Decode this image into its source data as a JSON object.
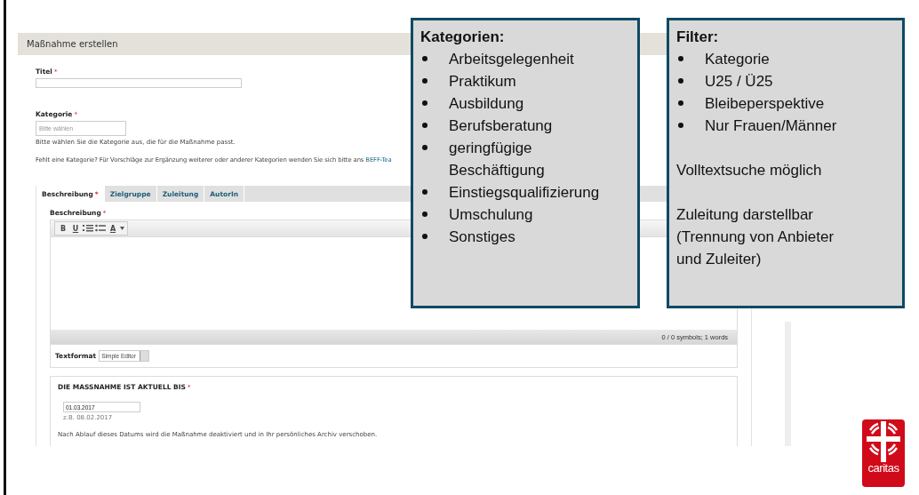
{
  "form_title": "Maßnahme erstellen",
  "title_field": {
    "label": "Titel",
    "marker": "*"
  },
  "category_field": {
    "label": "Kategorie",
    "marker": "*",
    "placeholder": "Bitte wählen",
    "help": "Bitte wählen Sie die Kategorie aus, die für die Maßnahme passt."
  },
  "missing_note": {
    "text": "Fehlt eine Kategorie? Für Vorschläge zur Ergänzung weiterer oder anderer Kategorien wenden Sie sich bitte ans",
    "link": "BEFF-Tea"
  },
  "tabs": [
    {
      "label": "Beschreibung",
      "marker": "*",
      "selected": true
    },
    {
      "label": "Zielgruppe",
      "selected": false
    },
    {
      "label": "Zuleitung",
      "selected": false
    },
    {
      "label": "AutorIn",
      "selected": false
    }
  ],
  "editor": {
    "label": "Beschreibung",
    "marker": "*",
    "toolbar": [
      {
        "kind": "bold",
        "label": "B"
      },
      {
        "kind": "underline",
        "label": "U"
      },
      {
        "kind": "ordered-list"
      },
      {
        "kind": "bullet-list"
      },
      {
        "kind": "font-color",
        "label": "A"
      }
    ],
    "status": "0 / 0 symbols; 1 words",
    "format_label": "Textformat",
    "format_value": "Simple Editor"
  },
  "valid_until": {
    "heading": "DIE MASSNAHME IST AKTUELL BIS",
    "marker": "*",
    "value": "01.03.2017",
    "example": "z.B. 08.02.2017",
    "note": "Nach Ablauf dieses Datums wird die Maßnahme deaktiviert und in Ihr persönliches Archiv verschoben."
  },
  "callouts": [
    {
      "title": "Kategorien:",
      "items": [
        "Arbeitsgelegenheit",
        "Praktikum",
        "Ausbildung",
        "Berufsberatung",
        "geringfügige Beschäftigung",
        "Einstiegsqualifizierung",
        "Umschulung",
        "Sonstiges"
      ]
    },
    {
      "title": "Filter:",
      "items": [
        "Kategorie",
        "U25 / Ü25",
        "Bleibeperspektive",
        "Nur Frauen/Männer"
      ],
      "notes": [
        "Volltextsuche möglich",
        "Zuleitung darstellbar (Trennung von Anbieter und Zuleiter)"
      ]
    }
  ],
  "logo": {
    "text": "caritas"
  }
}
